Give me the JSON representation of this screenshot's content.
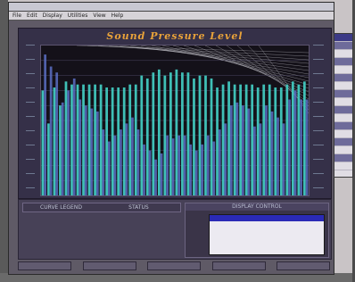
{
  "window": {
    "title": ""
  },
  "menu": {
    "items": [
      "File",
      "Edit",
      "Display",
      "Utilities",
      "View",
      "Help"
    ]
  },
  "chart_data": {
    "type": "bar",
    "title": "Sound Pressure Level",
    "series": [
      {
        "name": "",
        "values": [
          70,
          48,
          72,
          60,
          76,
          74,
          74,
          74,
          74,
          74,
          74,
          72,
          72,
          72,
          72,
          74,
          74,
          80,
          78,
          82,
          84,
          80,
          82,
          84,
          82,
          82,
          78,
          80,
          80,
          78,
          72,
          74,
          76,
          74,
          74,
          74,
          74,
          72,
          74,
          74,
          72,
          72,
          74,
          76,
          74,
          76
        ],
        "color": "#41c9bf"
      },
      {
        "name": "",
        "values": [
          94,
          86,
          82,
          62,
          70,
          78,
          64,
          60,
          58,
          56,
          44,
          36,
          40,
          44,
          48,
          52,
          44,
          34,
          30,
          24,
          28,
          40,
          38,
          40,
          40,
          34,
          30,
          34,
          40,
          36,
          44,
          48,
          60,
          62,
          60,
          58,
          46,
          48,
          60,
          56,
          52,
          48,
          64,
          70,
          64,
          64
        ],
        "color": "#5a6fc4"
      }
    ],
    "ylim": [
      0,
      100
    ],
    "grid": true
  },
  "legend": {
    "headers": [
      "CURVE LEGEND",
      "STATUS"
    ]
  },
  "panel": {
    "header": "DISPLAY CONTROL",
    "list_title": "",
    "list_items": []
  },
  "status": {
    "cells": [
      "",
      "",
      "",
      "",
      ""
    ]
  },
  "side_toolbar": {
    "label": ""
  }
}
